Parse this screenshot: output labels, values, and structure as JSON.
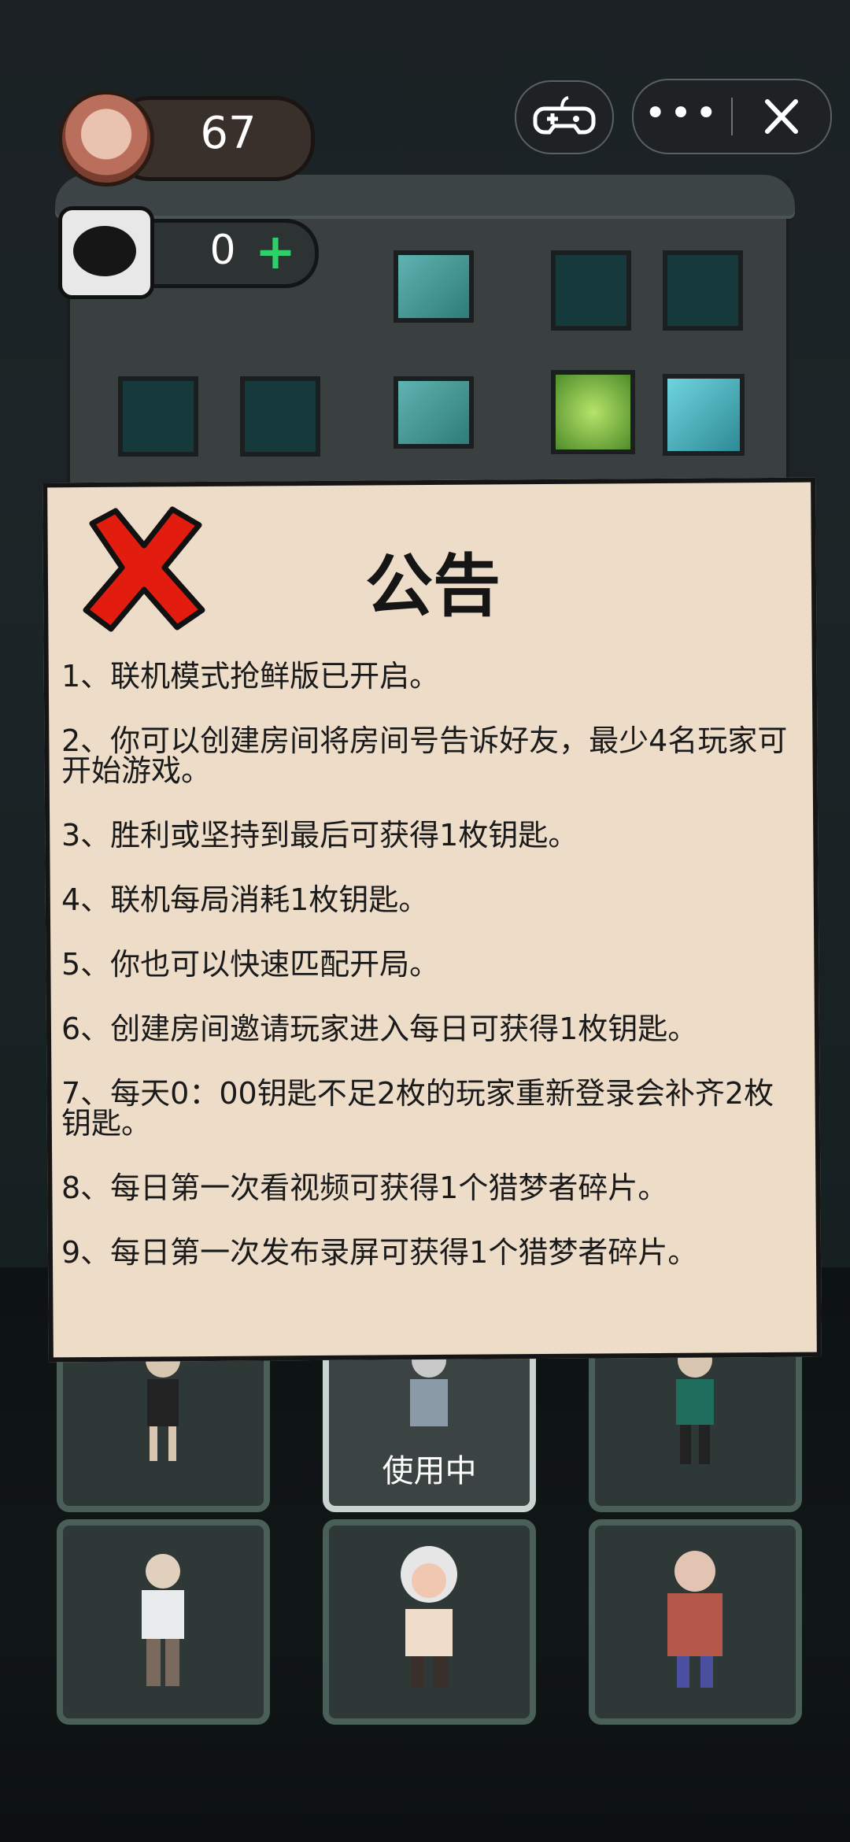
{
  "hud": {
    "coin_value": "67",
    "puzzle_value": "0",
    "plus_label": "+"
  },
  "top_right": {
    "more_label": "•••"
  },
  "notice": {
    "title": "公告",
    "items": [
      "1、联机模式抢鲜版已开启。",
      "2、你可以创建房间将房间号告诉好友，最少4名玩家可开始游戏。",
      "3、胜利或坚持到最后可获得1枚钥匙。",
      "4、联机每局消耗1枚钥匙。",
      "5、你也可以快速匹配开局。",
      "6、创建房间邀请玩家进入每日可获得1枚钥匙。",
      "7、每天0：00钥匙不足2枚的玩家重新登录会补齐2枚钥匙。",
      "8、每日第一次看视频可获得1个猎梦者碎片。",
      "9、每日第一次发布录屏可获得1个猎梦者碎片。"
    ]
  },
  "characters": {
    "in_use_label": "使用中"
  },
  "colors": {
    "panel_bg": "#ecdcc8",
    "close_x_red": "#e21d0f",
    "plus_green": "#2fcf6a",
    "card_border": "#4a5f57",
    "card_active_border": "#c9d3cf"
  }
}
